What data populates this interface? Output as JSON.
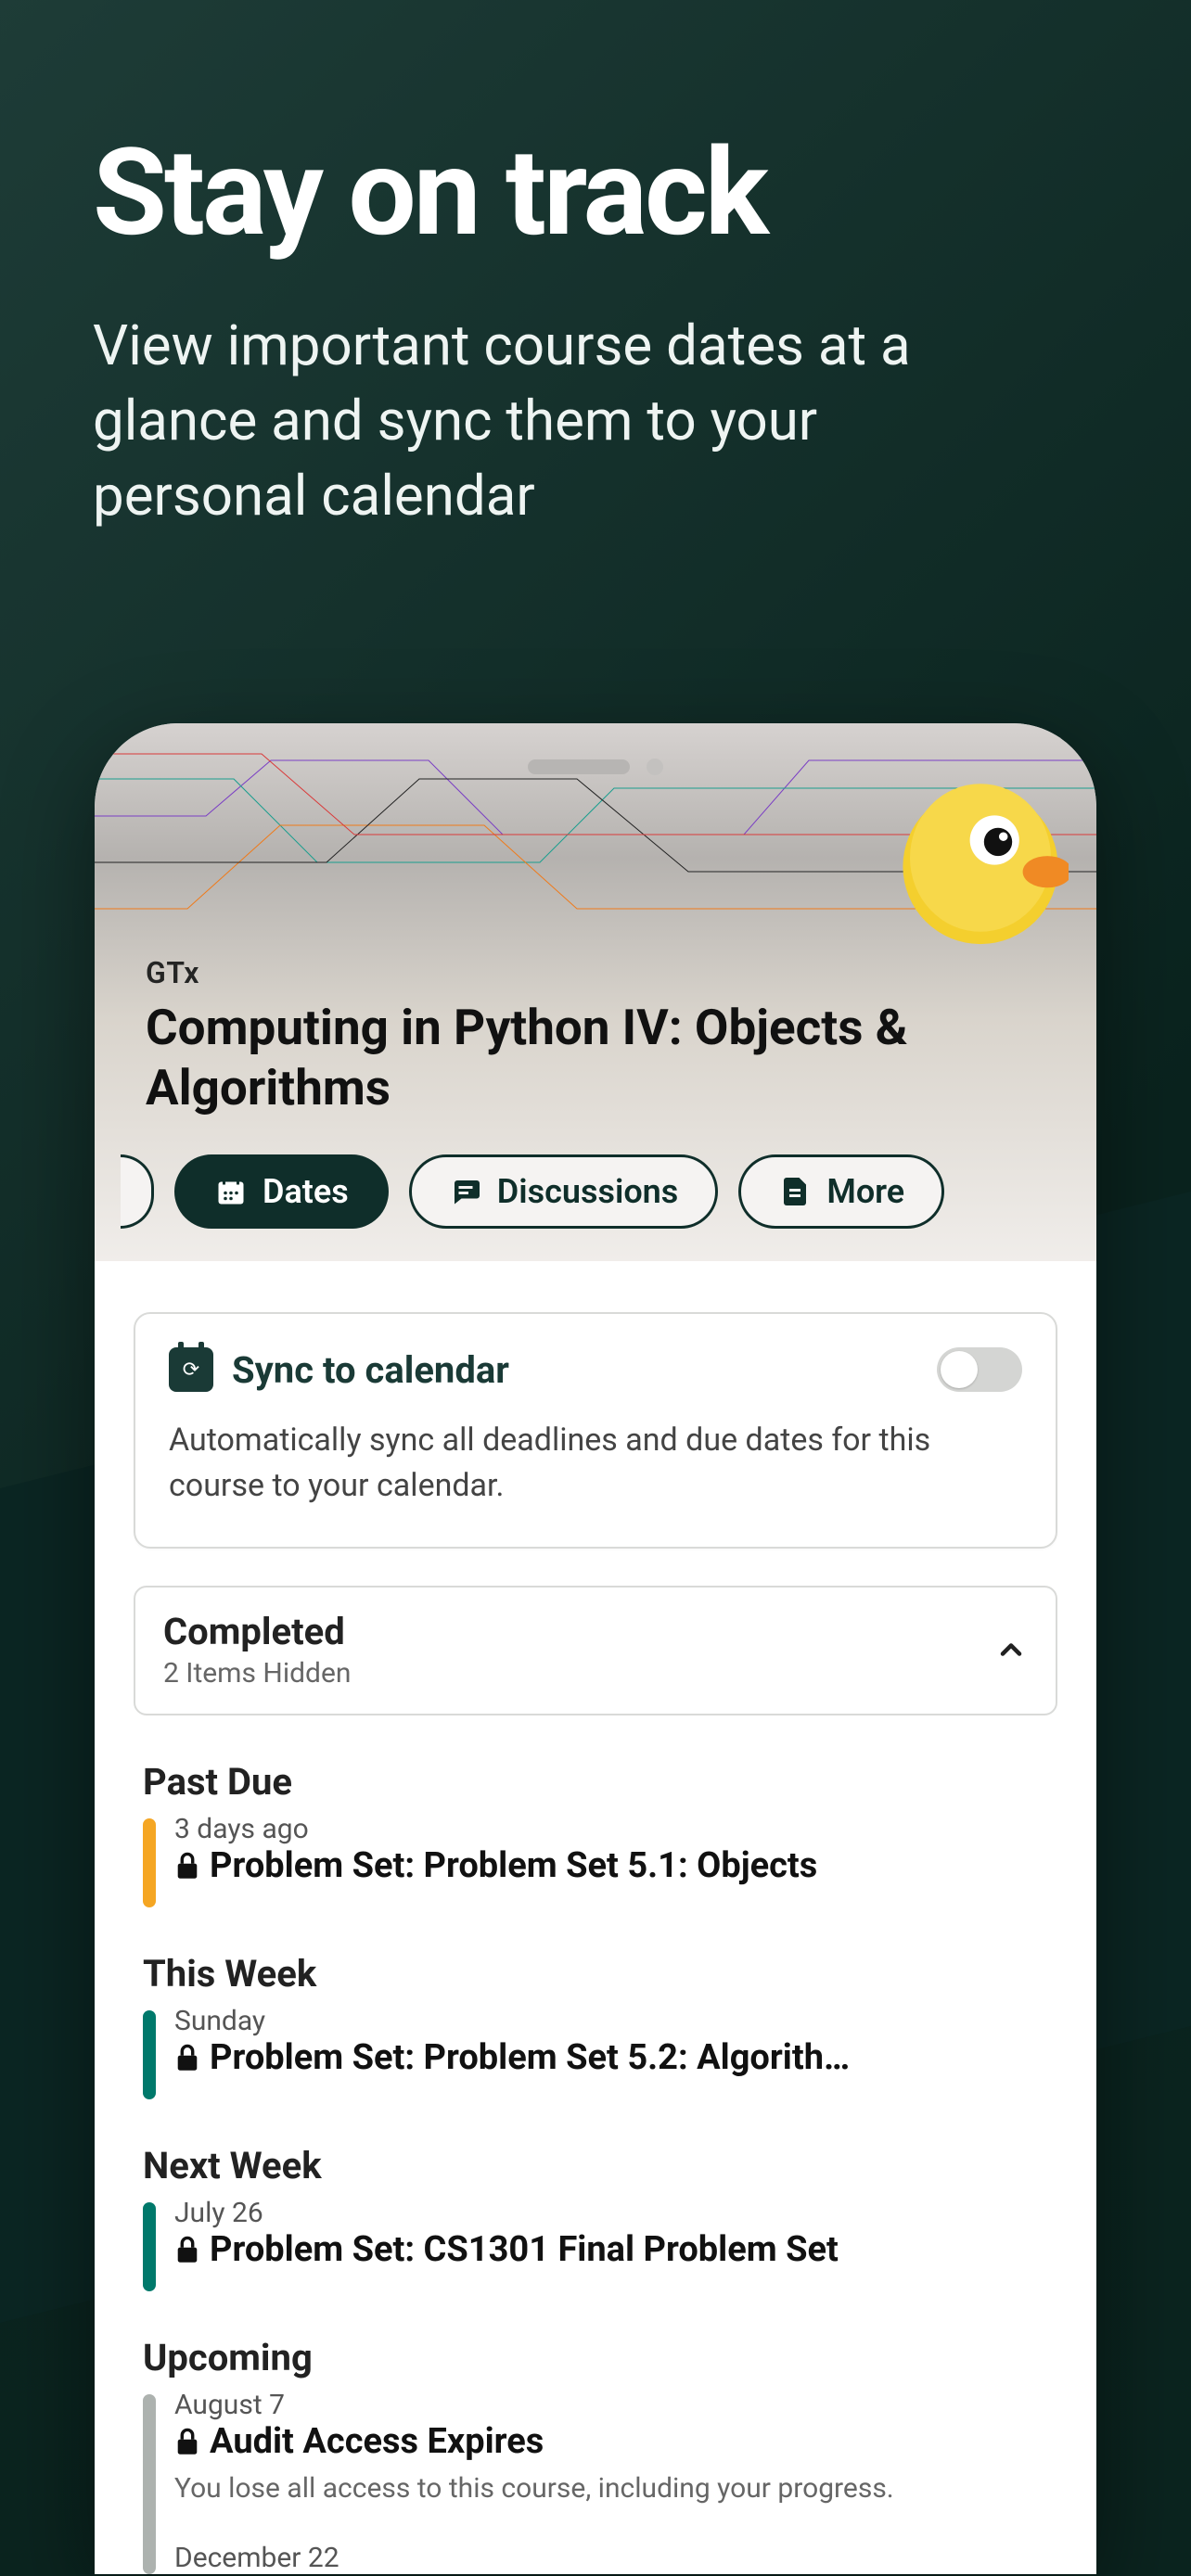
{
  "marketing": {
    "title": "Stay on track",
    "subtitle": "View important course dates at a glance and sync them to your personal calendar"
  },
  "course": {
    "org": "GTx",
    "title": "Computing in Python IV: Objects & Algorithms"
  },
  "tabs": {
    "dates": "Dates",
    "discussions": "Discussions",
    "more": "More"
  },
  "sync": {
    "title": "Sync to calendar",
    "description": "Automatically sync all deadlines and due dates for this course to your calendar."
  },
  "completed": {
    "title": "Completed",
    "subtitle": "2 Items Hidden"
  },
  "sections": {
    "past_due": {
      "heading": "Past Due",
      "items": [
        {
          "when": "3 days ago",
          "title": "Problem Set: Problem Set 5.1: Objects"
        }
      ]
    },
    "this_week": {
      "heading": "This Week",
      "items": [
        {
          "when": "Sunday",
          "title": "Problem Set: Problem Set 5.2: Algorith…"
        }
      ]
    },
    "next_week": {
      "heading": "Next Week",
      "items": [
        {
          "when": "July 26",
          "title": "Problem Set: CS1301 Final Problem Set"
        }
      ]
    },
    "upcoming": {
      "heading": "Upcoming",
      "items": [
        {
          "when": "August 7",
          "title": "Audit Access Expires",
          "description": "You lose all access to this course, including your progress."
        },
        {
          "when": "December 22",
          "title": "",
          "description": ""
        }
      ]
    }
  }
}
